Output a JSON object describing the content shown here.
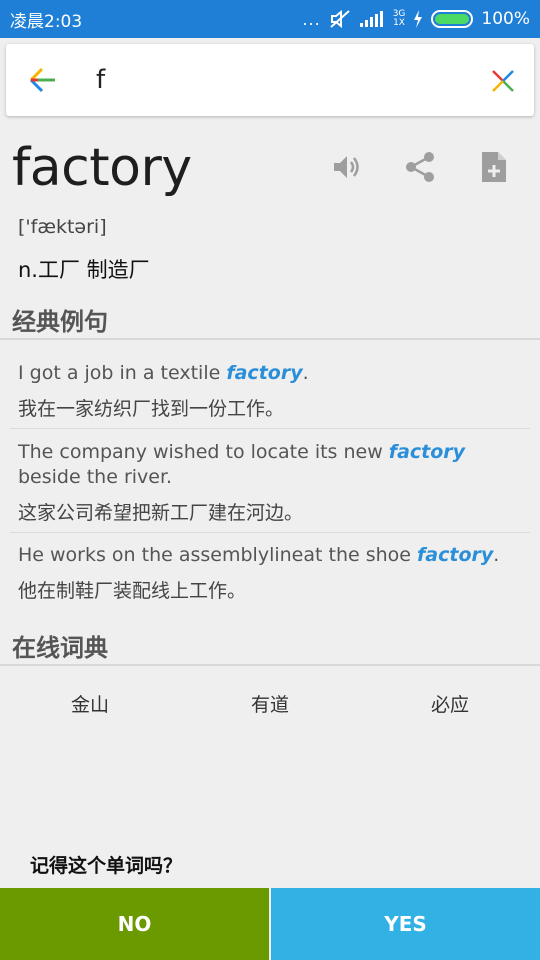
{
  "status_bar": {
    "time": "凌晨2:03",
    "dots": "...",
    "network_top": "3G",
    "network_bottom": "1X",
    "battery_percent": "100%",
    "battery_level": 1.0
  },
  "search": {
    "query": "f",
    "back_icon": "arrow-left-icon",
    "clear_icon": "close-icon"
  },
  "entry": {
    "word": "factory",
    "phonetic": "['fæktəri]",
    "meaning": "n.工厂 制造厂",
    "action_icons": [
      "speaker-icon",
      "share-icon",
      "add-file-icon"
    ]
  },
  "examples_section": {
    "title": "经典例句",
    "items": [
      {
        "en_before": "I got a job in a textile ",
        "en_word": "factory",
        "en_after": ".",
        "zh": "我在一家纺织厂找到一份工作。"
      },
      {
        "en_before": "The company wished to locate its new ",
        "en_word": "factory",
        "en_after": " beside the river.",
        "zh": "这家公司希望把新工厂建在河边。"
      },
      {
        "en_before": "He works on the assemblylineat the shoe ",
        "en_word": "factory",
        "en_after": ".",
        "zh": "他在制鞋厂装配线上工作。"
      }
    ]
  },
  "online_section": {
    "title": "在线词典",
    "dictionaries": [
      "金山",
      "有道",
      "必应"
    ]
  },
  "review": {
    "question": "记得这个单词吗？",
    "no_label": "NO",
    "yes_label": "YES"
  },
  "colors": {
    "status_bar": "#1f7fd6",
    "accent_word": "#2a8fd8",
    "no_button": "#6a9a00",
    "yes_button": "#31b1e4"
  }
}
